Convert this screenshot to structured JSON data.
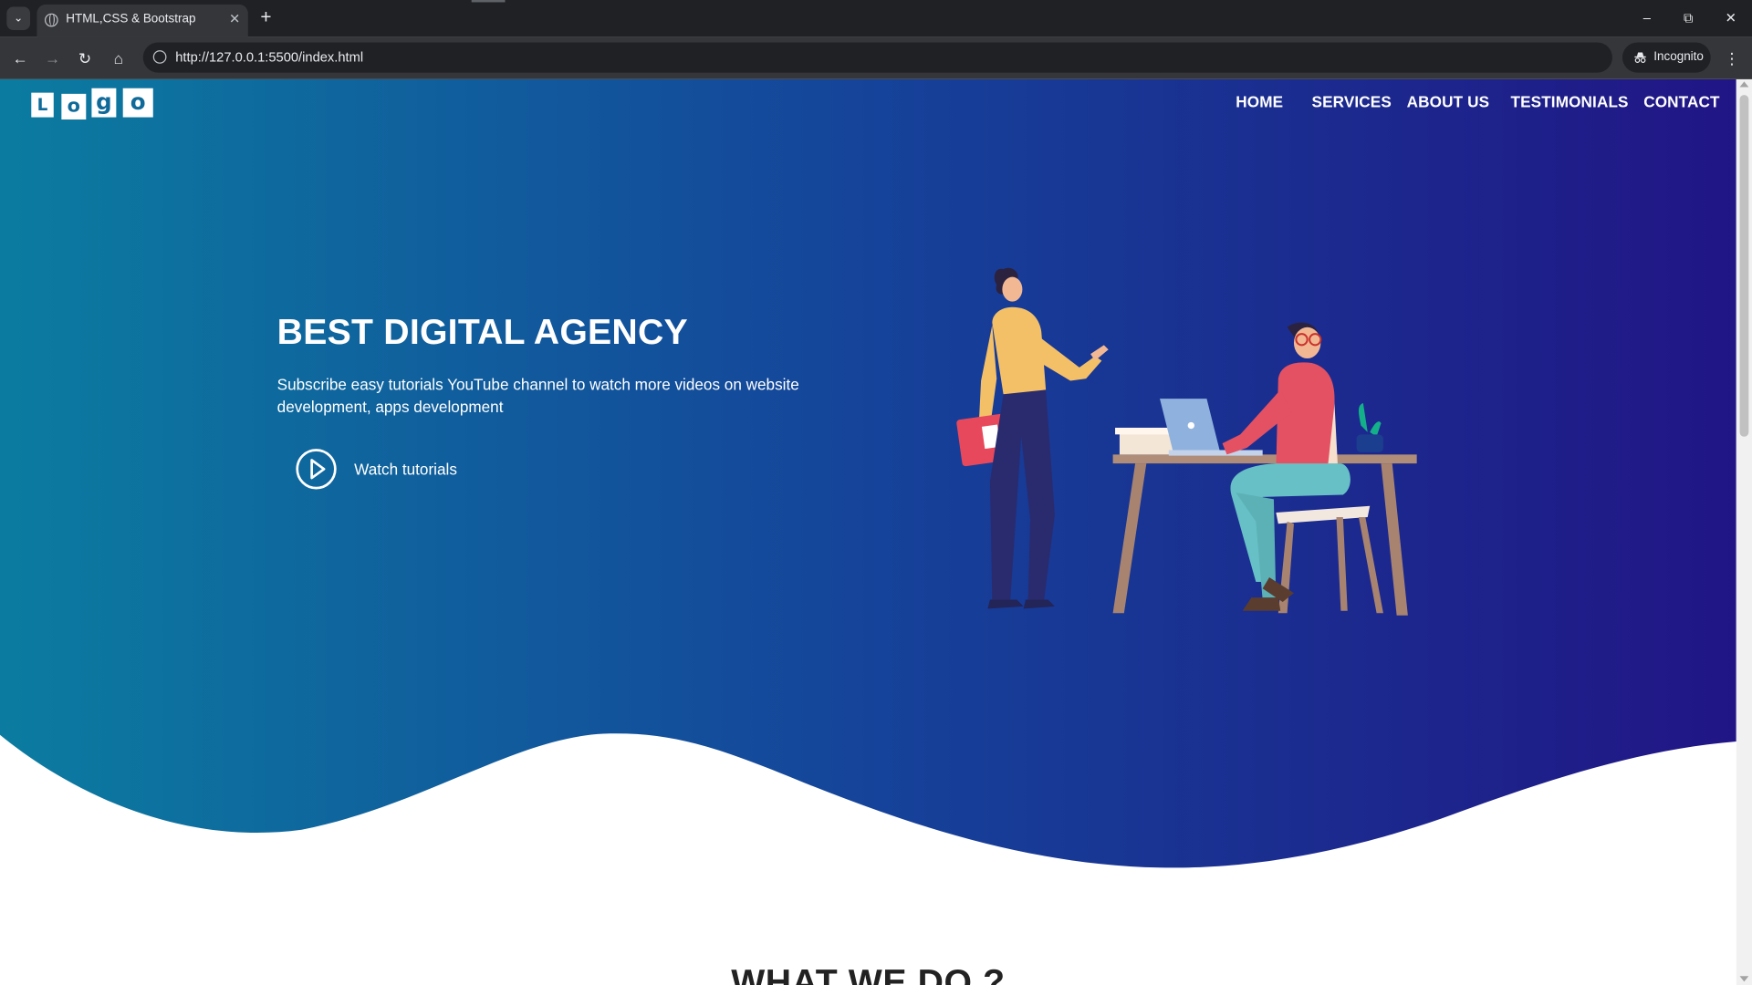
{
  "browser": {
    "tab_title": "HTML,CSS & Bootstrap",
    "url": "http://127.0.0.1:5500/index.html",
    "incognito_label": "Incognito"
  },
  "page": {
    "logo_letters": [
      "L",
      "o",
      "g",
      "o"
    ],
    "nav": [
      "HOME",
      "SERVICES",
      "ABOUT US",
      "TESTIMONIALS",
      "CONTACT"
    ],
    "hero": {
      "title": "BEST DIGITAL AGENCY",
      "subtitle": "Subscribe easy tutorials YouTube channel to watch more videos on website development, apps development",
      "cta_label": "Watch tutorials"
    },
    "section_title": "WHAT WE DO ?",
    "colors": {
      "gradient_start": "#0b7ca0",
      "gradient_mid": "#15439a",
      "gradient_end": "#211585",
      "text": "#ffffff"
    }
  }
}
